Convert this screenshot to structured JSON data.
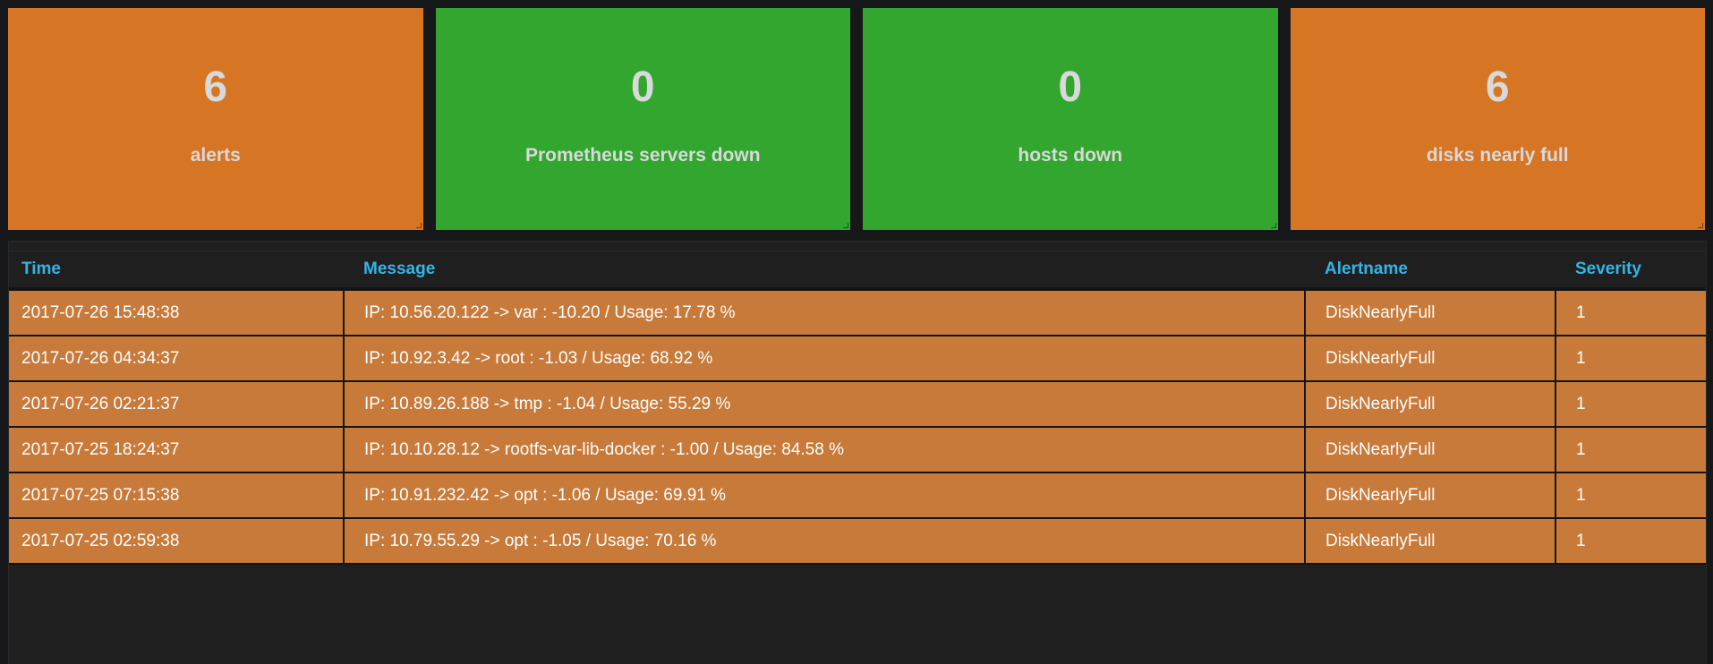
{
  "stats": [
    {
      "value": "6",
      "label": "alerts",
      "color": "#d67524"
    },
    {
      "value": "0",
      "label": "Prometheus servers down",
      "color": "#32a62e"
    },
    {
      "value": "0",
      "label": "hosts down",
      "color": "#32a62e"
    },
    {
      "value": "6",
      "label": "disks nearly full",
      "color": "#d67524"
    }
  ],
  "table": {
    "columns": [
      "Time",
      "Message",
      "Alertname",
      "Severity"
    ],
    "rows": [
      {
        "time": "2017-07-26 15:48:38",
        "message": "IP: 10.56.20.122 -> var : -10.20 / Usage: 17.78 %",
        "alertname": "DiskNearlyFull",
        "severity": "1"
      },
      {
        "time": "2017-07-26 04:34:37",
        "message": "IP: 10.92.3.42 -> root : -1.03 / Usage: 68.92 %",
        "alertname": "DiskNearlyFull",
        "severity": "1"
      },
      {
        "time": "2017-07-26 02:21:37",
        "message": "IP: 10.89.26.188 -> tmp : -1.04 / Usage: 55.29 %",
        "alertname": "DiskNearlyFull",
        "severity": "1"
      },
      {
        "time": "2017-07-25 18:24:37",
        "message": "IP: 10.10.28.12 -> rootfs-var-lib-docker : -1.00 / Usage: 84.58 %",
        "alertname": "DiskNearlyFull",
        "severity": "1"
      },
      {
        "time": "2017-07-25 07:15:38",
        "message": "IP: 10.91.232.42 -> opt : -1.06 / Usage: 69.91 %",
        "alertname": "DiskNearlyFull",
        "severity": "1"
      },
      {
        "time": "2017-07-25 02:59:38",
        "message": "IP: 10.79.55.29 -> opt : -1.05 / Usage: 70.16 %",
        "alertname": "DiskNearlyFull",
        "severity": "1"
      }
    ]
  }
}
